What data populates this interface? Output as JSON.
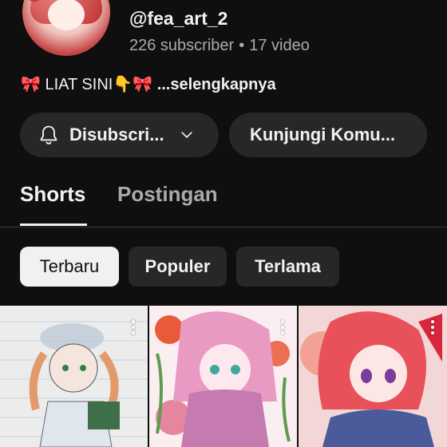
{
  "channel": {
    "handle": "@fea_art_2",
    "subscribers": "226 subscriber",
    "videos": "17 video",
    "separator": "•",
    "description_emoji_left": "🎀",
    "description_text": "LIAT SINI",
    "description_emoji_point": "👇",
    "description_emoji_right": "🎀",
    "description_more": "...selengkapnya"
  },
  "actions": {
    "subscribe_label": "Disubscri...",
    "community_label": "Kunjungi Komu..."
  },
  "tabs": [
    {
      "label": "Shorts",
      "active": true
    },
    {
      "label": "Postingan",
      "active": false
    }
  ],
  "filters": [
    {
      "label": "Terbaru",
      "selected": true
    },
    {
      "label": "Populer",
      "selected": false
    },
    {
      "label": "Terlama",
      "selected": false
    }
  ],
  "icons": {
    "bell": "bell-icon",
    "chevron": "chevron-down-icon",
    "more": "more-vertical-icon"
  },
  "colors": {
    "background": "#0f0f0f",
    "surface": "#272727",
    "text_primary": "#f1f1f1",
    "text_secondary": "#aaaaaa",
    "chip_active_bg": "#f1f1f1"
  }
}
